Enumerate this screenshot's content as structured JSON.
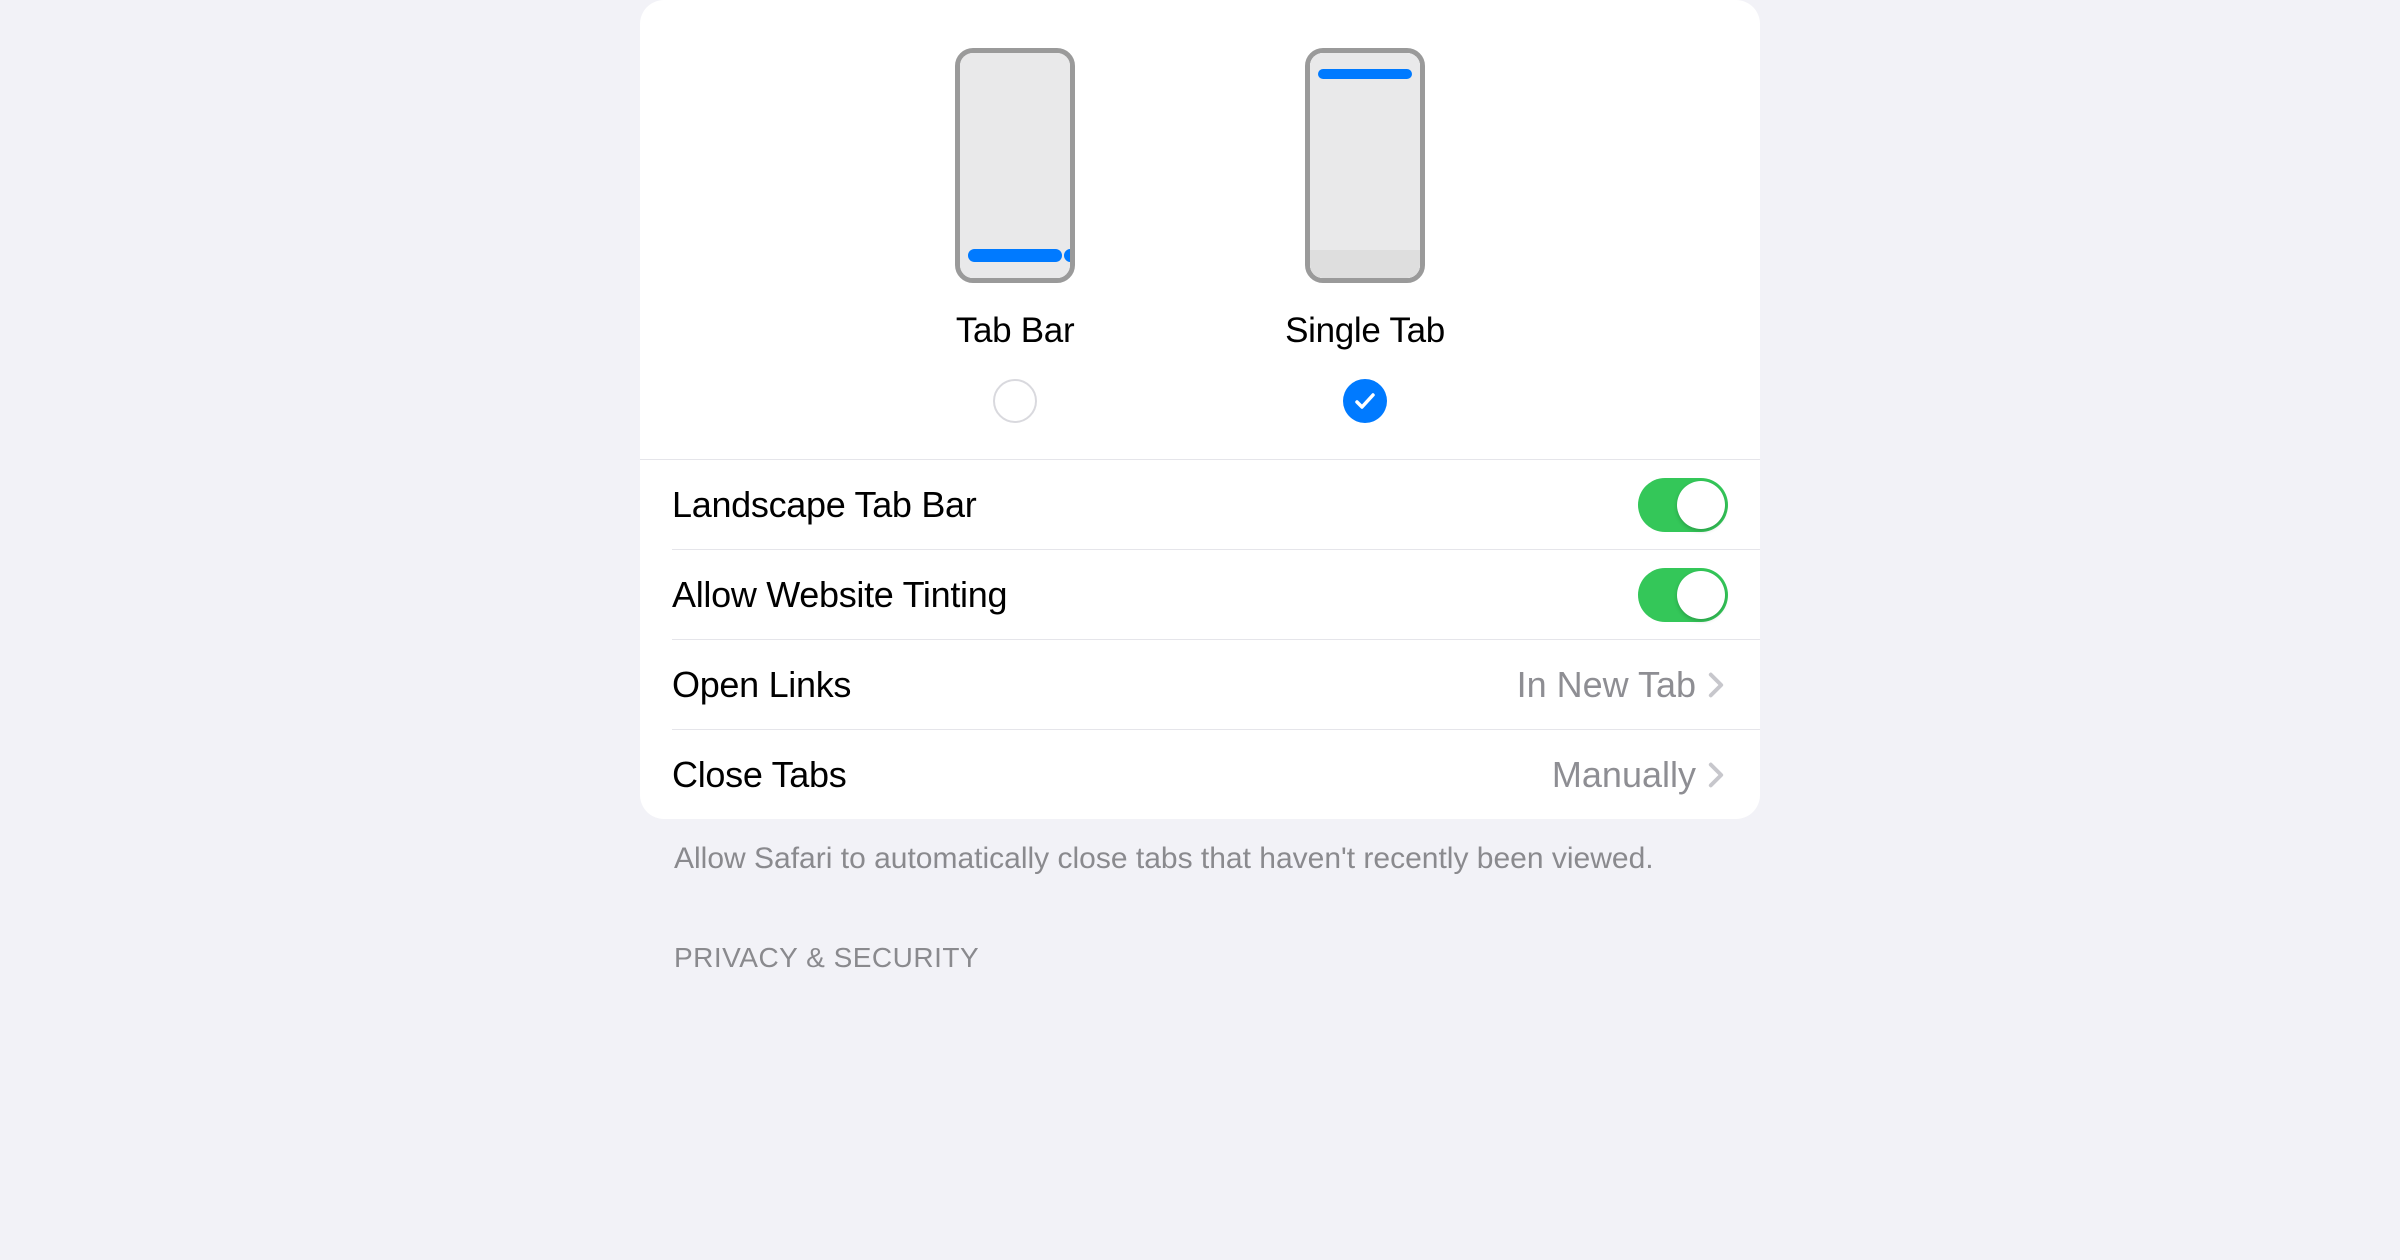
{
  "layout_options": {
    "tab_bar": {
      "label": "Tab Bar",
      "selected": false
    },
    "single_tab": {
      "label": "Single Tab",
      "selected": true
    }
  },
  "settings": {
    "landscape_tab_bar": {
      "label": "Landscape Tab Bar",
      "enabled": true
    },
    "allow_website_tinting": {
      "label": "Allow Website Tinting",
      "enabled": true
    },
    "open_links": {
      "label": "Open Links",
      "value": "In New Tab"
    },
    "close_tabs": {
      "label": "Close Tabs",
      "value": "Manually"
    }
  },
  "footer_note": "Allow Safari to automatically close tabs that haven't recently been viewed.",
  "next_section_header": "PRIVACY & SECURITY",
  "colors": {
    "accent": "#007aff",
    "toggle_on": "#34c759"
  }
}
